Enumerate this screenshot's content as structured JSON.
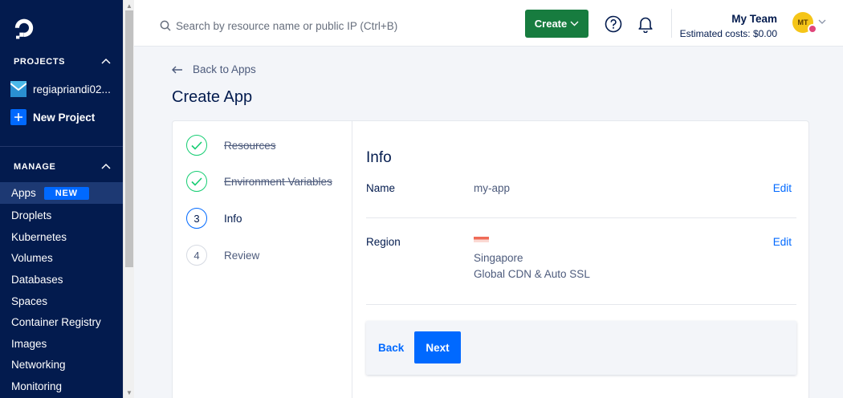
{
  "sidebar": {
    "projects_heading": "PROJECTS",
    "projects": [
      {
        "label": "regiapriandi02...",
        "icon": "project-logo-icon"
      },
      {
        "label": "New Project",
        "icon": "plus-icon"
      }
    ],
    "manage_heading": "MANAGE",
    "nav": [
      {
        "label": "Apps",
        "badge": "NEW",
        "active": true
      },
      {
        "label": "Droplets"
      },
      {
        "label": "Kubernetes"
      },
      {
        "label": "Volumes"
      },
      {
        "label": "Databases"
      },
      {
        "label": "Spaces"
      },
      {
        "label": "Container Registry"
      },
      {
        "label": "Images"
      },
      {
        "label": "Networking"
      },
      {
        "label": "Monitoring"
      }
    ]
  },
  "header": {
    "search_placeholder": "Search by resource name or public IP (Ctrl+B)",
    "create_label": "Create",
    "team_name": "My Team",
    "estimated_costs": "Estimated costs: $0.00",
    "avatar_initials": "MT"
  },
  "page": {
    "back_link": "Back to Apps",
    "title": "Create App"
  },
  "steps": [
    {
      "label": "Resources",
      "state": "done",
      "marker": ""
    },
    {
      "label": "Environment Variables",
      "state": "done",
      "marker": ""
    },
    {
      "label": "Info",
      "state": "current",
      "marker": "3"
    },
    {
      "label": "Review",
      "state": "todo",
      "marker": "4"
    }
  ],
  "info": {
    "title": "Info",
    "name_label": "Name",
    "name_value": "my-app",
    "name_edit": "Edit",
    "region_label": "Region",
    "region_value": "Singapore",
    "region_subvalue": "Global CDN & Auto SSL",
    "region_edit": "Edit",
    "region_flag": "singapore-flag-icon"
  },
  "actions": {
    "back_label": "Back",
    "next_label": "Next"
  },
  "colors": {
    "sidebar_bg": "#031b4e",
    "accent_blue": "#0069ff",
    "create_green": "#177c3f",
    "step_done": "#15cd72"
  }
}
